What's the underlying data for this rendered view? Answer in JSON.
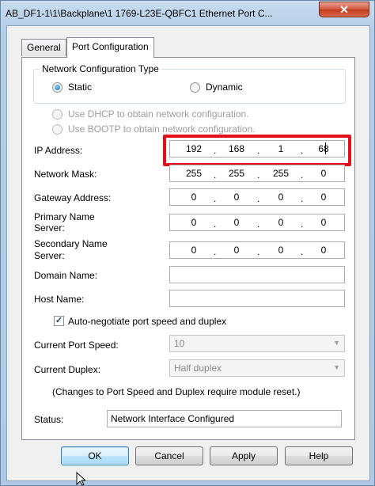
{
  "window": {
    "title": "AB_DF1-1\\1\\Backplane\\1 1769-L23E-QBFC1 Ethernet Port C...",
    "close_glyph": "✕"
  },
  "tabs": [
    {
      "label": "General",
      "active": false
    },
    {
      "label": "Port Configuration",
      "active": true
    }
  ],
  "network_config_type": {
    "legend": "Network Configuration Type",
    "options": [
      {
        "label": "Static",
        "selected": true
      },
      {
        "label": "Dynamic",
        "selected": false
      }
    ]
  },
  "dynamic_options": [
    {
      "label": "Use DHCP to obtain network configuration.",
      "enabled": false
    },
    {
      "label": "Use BOOTP to obtain network configuration.",
      "enabled": false
    }
  ],
  "fields": {
    "ip_address": {
      "label": "IP Address:",
      "octets": [
        "192",
        "168",
        "1",
        "68"
      ]
    },
    "network_mask": {
      "label": "Network Mask:",
      "octets": [
        "255",
        "255",
        "255",
        "0"
      ]
    },
    "gateway": {
      "label": "Gateway Address:",
      "octets": [
        "0",
        "0",
        "0",
        "0"
      ]
    },
    "primary_ns": {
      "label_line1": "Primary Name",
      "label_line2": "Server:",
      "octets": [
        "0",
        "0",
        "0",
        "0"
      ]
    },
    "secondary_ns": {
      "label_line1": "Secondary Name",
      "label_line2": "Server:",
      "octets": [
        "0",
        "0",
        "0",
        "0"
      ]
    },
    "domain_name": {
      "label": "Domain Name:",
      "value": ""
    },
    "host_name": {
      "label": "Host Name:",
      "value": ""
    }
  },
  "autonegotiate": {
    "label": "Auto-negotiate port speed and duplex",
    "checked": true,
    "check_glyph": "✓"
  },
  "port_speed": {
    "label": "Current Port Speed:",
    "value": "10"
  },
  "duplex": {
    "label": "Current Duplex:",
    "value": "Half duplex"
  },
  "note": "(Changes to Port Speed and Duplex require module reset.)",
  "status": {
    "label": "Status:",
    "value": "Network Interface Configured"
  },
  "buttons": {
    "ok": "OK",
    "cancel": "Cancel",
    "apply": "Apply",
    "help": "Help"
  },
  "colors": {
    "highlight": "#e3101c",
    "accent": "#3c7fb1"
  }
}
